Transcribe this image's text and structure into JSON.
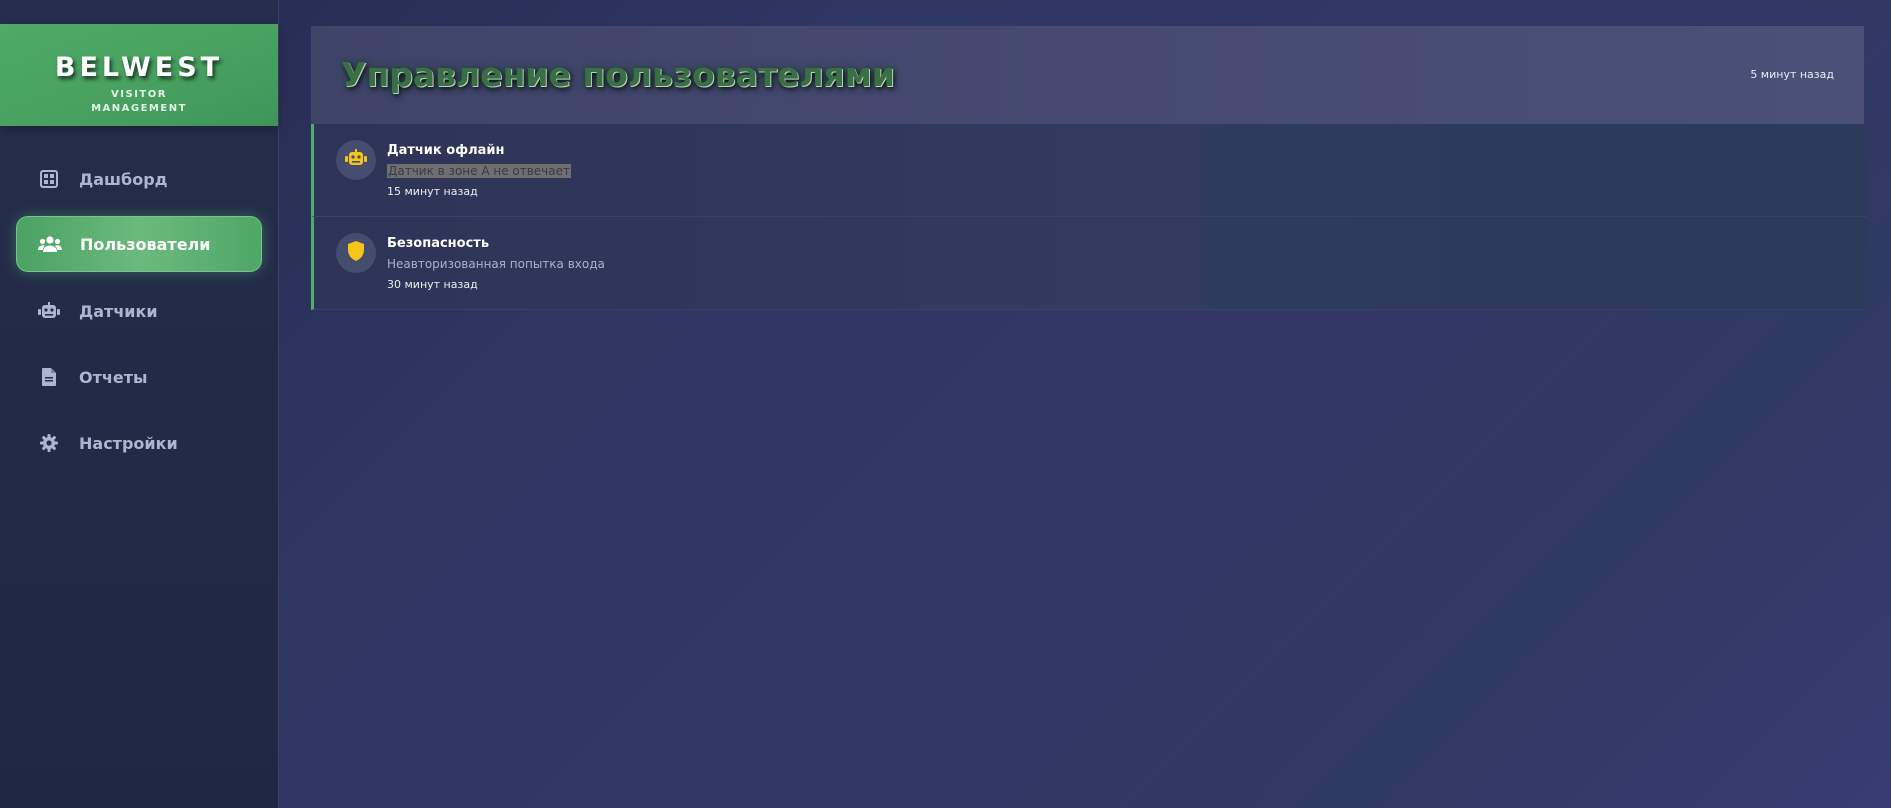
{
  "brand": {
    "title": "BELWEST",
    "subtitle": "VISITOR MANAGEMENT"
  },
  "sidebar": {
    "items": [
      {
        "label": "Дашборд",
        "icon": "grid-icon",
        "active": false
      },
      {
        "label": "Пользователи",
        "icon": "users-icon",
        "active": true
      },
      {
        "label": "Датчики",
        "icon": "robot-icon",
        "active": false
      },
      {
        "label": "Отчеты",
        "icon": "file-icon",
        "active": false
      },
      {
        "label": "Настройки",
        "icon": "gear-icon",
        "active": false
      }
    ]
  },
  "header": {
    "title": "Управление пользователями",
    "time": "5 минут назад"
  },
  "notifications": [
    {
      "title": "Датчик офлайн",
      "message": "Датчик в зоне А не отвечает",
      "time": "15 минут назад",
      "icon": "robot-icon",
      "message_highlighted": true
    },
    {
      "title": "Безопасность",
      "message": "Неавторизованная попытка входа",
      "time": "30 минут назад",
      "icon": "shield-icon",
      "message_highlighted": false
    }
  ],
  "colors": {
    "accent": "#4cae67",
    "icon_yellow": "#f5c518",
    "sidebar_bg": "#232b49",
    "page_bg": "#2f3763"
  }
}
